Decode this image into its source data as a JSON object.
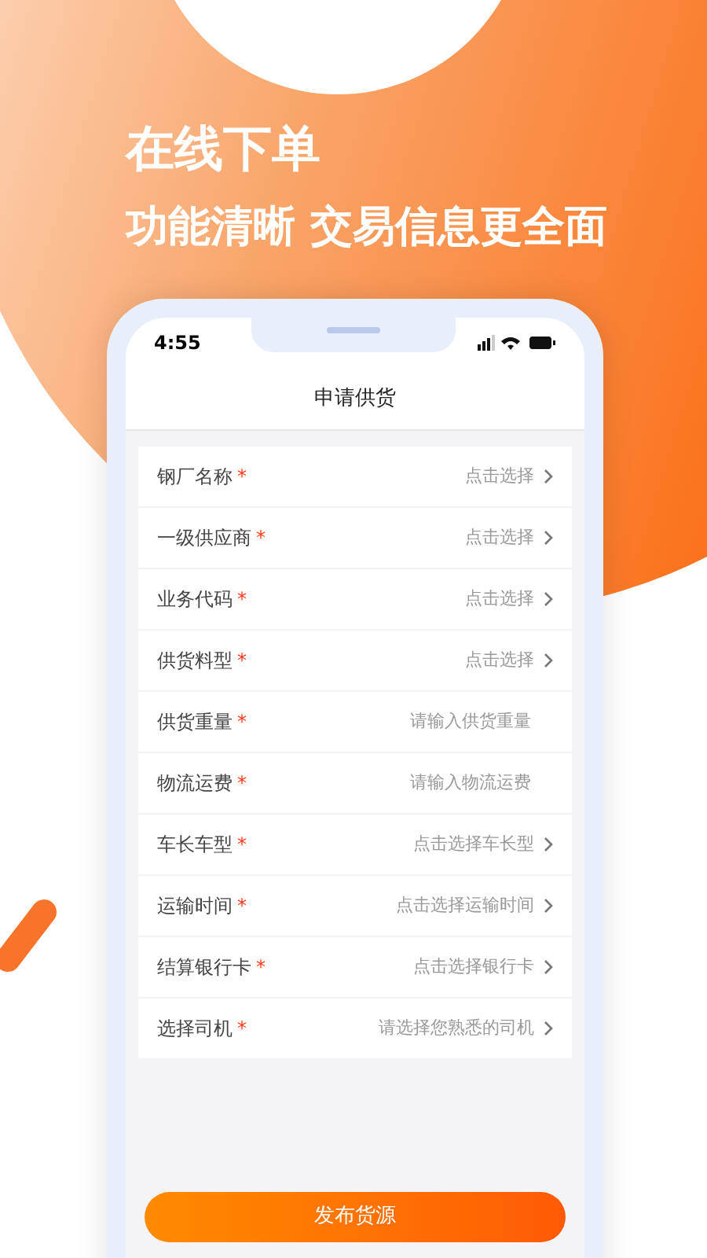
{
  "headline": {
    "title": "在线下单",
    "subtitle": "功能清晰 交易信息更全面"
  },
  "status_bar": {
    "time": "4:55"
  },
  "screen_title": "申请供货",
  "form_rows": [
    {
      "label": "钢厂名称",
      "required_mark": "*",
      "hint": "点击选择",
      "kind": "select"
    },
    {
      "label": "一级供应商",
      "required_mark": "*",
      "hint": "点击选择",
      "kind": "select"
    },
    {
      "label": "业务代码",
      "required_mark": "*",
      "hint": "点击选择",
      "kind": "select"
    },
    {
      "label": "供货料型",
      "required_mark": "*",
      "hint": "点击选择",
      "kind": "select"
    },
    {
      "label": "供货重量",
      "required_mark": "*",
      "hint": "请输入供货重量",
      "kind": "input"
    },
    {
      "label": "物流运费",
      "required_mark": "*",
      "hint": "请输入物流运费",
      "kind": "input"
    },
    {
      "label": "车长车型",
      "required_mark": "*",
      "hint": "点击选择车长型",
      "kind": "select"
    },
    {
      "label": "运输时间",
      "required_mark": "*",
      "hint": "点击选择运输时间",
      "kind": "select"
    },
    {
      "label": "结算银行卡",
      "required_mark": "*",
      "hint": "点击选择银行卡",
      "kind": "select"
    },
    {
      "label": "选择司机",
      "required_mark": "*",
      "hint": "请选择您熟悉的司机",
      "kind": "select"
    }
  ],
  "submit_button": "发布货源"
}
